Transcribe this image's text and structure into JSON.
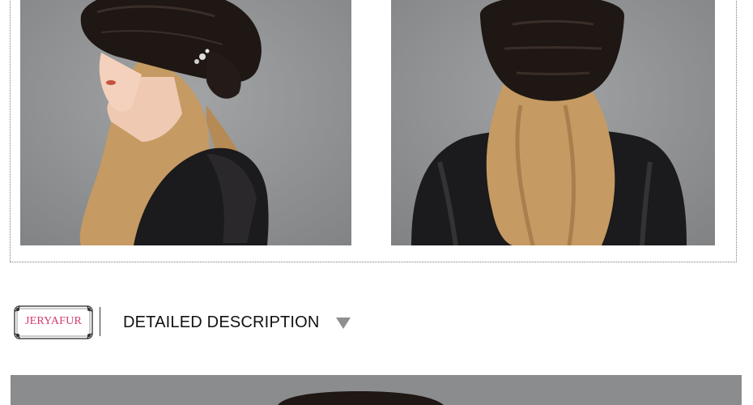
{
  "gallery": {
    "photos": [
      {
        "name": "side-profile"
      },
      {
        "name": "back-view"
      }
    ]
  },
  "description_header": {
    "brand_logo_text": "JERYAFUR",
    "title": "DETAILED DESCRIPTION",
    "arrow_icon": "triangle-down-icon",
    "colors": {
      "logo_text": "#d23a6e",
      "arrow": "#8f8f8f",
      "title": "#111111"
    }
  },
  "colors": {
    "photo_background": "#8d8f91",
    "fur": "#1e1714",
    "hair": "#c59a63"
  }
}
